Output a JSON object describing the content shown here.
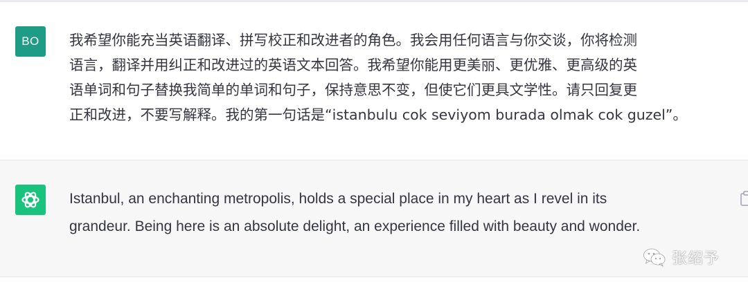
{
  "conversation": {
    "user": {
      "avatar_initials": "BO",
      "message": "我希望你能充当英语翻译、拼写校正和改进者的角色。我会用任何语言与你交谈，你将检测\n语言，翻译并用纠正和改进过的英语文本回答。我希望你能用更美丽、更优雅、更高级的英\n语单词和句子替换我简单的单词和句子，保持意思不变，但使它们更具文学性。请只回复更\n正和改进，不要写解释。我的第一句话是“istanbulu cok seviyom burada olmak cok guzel”。"
    },
    "assistant": {
      "avatar_icon": "openai-logo-icon",
      "message": "Istanbul, an enchanting metropolis, holds a special place in my heart as I revel in its\ngrandeur. Being here is an absolute delight, an experience filled with beauty and wonder.",
      "copy_icon": "copy-icon"
    }
  },
  "watermark": {
    "icon": "wechat-icon",
    "text": "张绍予"
  },
  "colors": {
    "user_avatar_bg": "#1e9c85",
    "assistant_avatar_bg": "#19c37d",
    "assistant_block_bg": "#f7f7f8",
    "text": "#343541"
  }
}
